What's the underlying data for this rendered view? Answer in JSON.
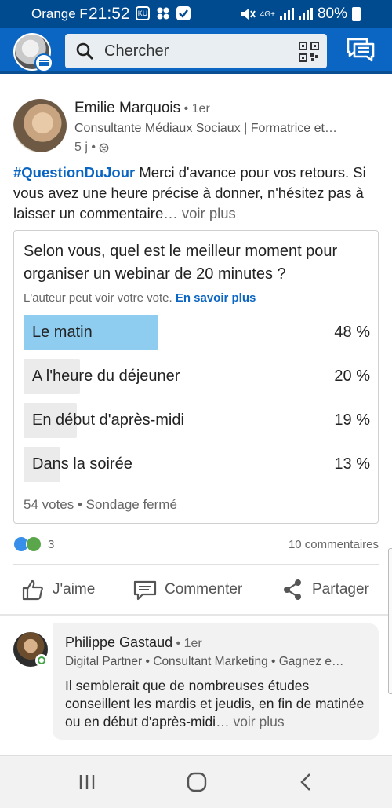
{
  "status_bar": {
    "carrier": "Orange F",
    "time": "21:52",
    "network": "4G+",
    "battery": "80%"
  },
  "app_bar": {
    "search_placeholder": "Chercher"
  },
  "post": {
    "author": {
      "name": "Emilie Marquois",
      "degree": " • 1er",
      "title": "Consultante Médiaux Sociaux | Formatrice et…"
    },
    "age": "5 j •",
    "hashtag": "#QuestionDuJour",
    "text": " Merci d'avance pour vos retours. Si vous avez une heure précise à donner, n'hésitez pas à laisser un commentaire",
    "see_more": "… voir plus"
  },
  "poll": {
    "question": "Selon vous, quel est le meilleur moment pour organiser un webinar de 20 minutes ?",
    "note": "L'auteur peut voir votre vote.",
    "learn_more": "En savoir plus",
    "options": [
      {
        "label": "Le matin",
        "percent": "48 %",
        "share": 0.48,
        "selected": true
      },
      {
        "label": "A l'heure du déjeuner",
        "percent": "20 %",
        "share": 0.2,
        "selected": false
      },
      {
        "label": "En début d'après-midi",
        "percent": "19 %",
        "share": 0.19,
        "selected": false
      },
      {
        "label": "Dans la soirée",
        "percent": "13 %",
        "share": 0.13,
        "selected": false
      }
    ],
    "footer": "54 votes • Sondage fermé"
  },
  "social": {
    "reaction_count": "3",
    "comments": "10 commentaires"
  },
  "actions": {
    "like": "J'aime",
    "comment": "Commenter",
    "share": "Partager"
  },
  "comment": {
    "name": "Philippe Gastaud",
    "degree": " • 1er",
    "title": "Digital Partner • Consultant Marketing • Gagnez e…",
    "text": "Il semblerait que de nombreuses études conseillent les mardis et jeudis, en fin de matinée ou en début d'après-midi",
    "see_more": "… voir plus"
  },
  "colors": {
    "brand_blue": "#0a66c2",
    "status_bar": "#004a8f",
    "poll_selected": "#8ecdf0",
    "poll_unselected": "#ebebeb"
  }
}
